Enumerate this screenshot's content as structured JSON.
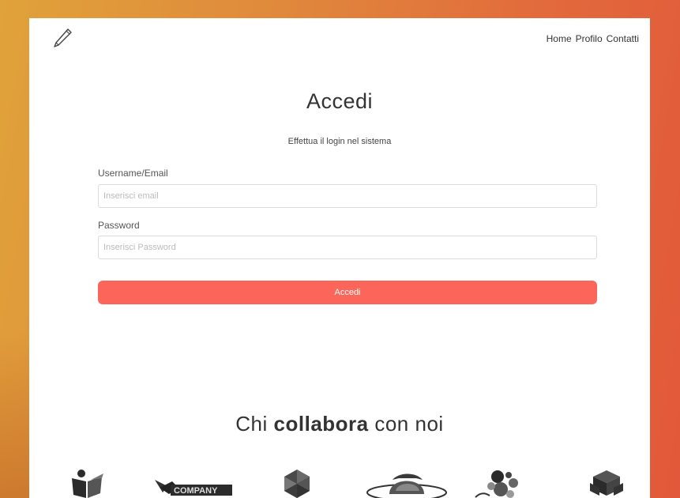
{
  "header": {
    "logo_icon": "pencil-icon",
    "nav": [
      "Home",
      "Profilo",
      "Contatti"
    ]
  },
  "login": {
    "title": "Accedi",
    "subtitle": "Effettua il login nel sistema",
    "username_label": "Username/Email",
    "username_placeholder": "Inserisci email",
    "username_value": "",
    "password_label": "Password",
    "password_placeholder": "Inserisci Password",
    "password_value": "",
    "submit_label": "Accedi"
  },
  "partners": {
    "title_prefix": "Chi ",
    "title_bold": "collabora",
    "title_suffix": " con noi",
    "logos": [
      {
        "icon": "open-book-icon"
      },
      {
        "icon": "rocket-company-logo",
        "text": "COMPANY"
      },
      {
        "icon": "geometric-sphere-icon"
      },
      {
        "icon": "spaceman-helmet-icon"
      },
      {
        "icon": "molecule-icon"
      },
      {
        "icon": "stacked-cubes-icon"
      }
    ]
  },
  "colors": {
    "accent": "#fc665a",
    "background_start": "#e0a23a",
    "background_end": "#e2583a"
  }
}
